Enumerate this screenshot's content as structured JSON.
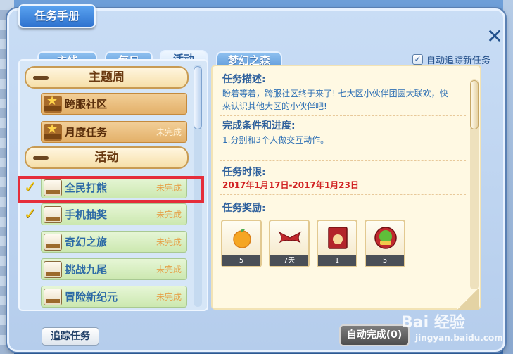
{
  "window": {
    "title": "任务手册",
    "close_symbol": "✕"
  },
  "tabs": [
    {
      "label": "主线",
      "active": false
    },
    {
      "label": "每日",
      "active": false
    },
    {
      "label": "活动",
      "active": true
    },
    {
      "label": "梦幻之森",
      "active": false
    }
  ],
  "auto_track": {
    "label": "自动追踪新任务",
    "checked": true,
    "check_symbol": "✓"
  },
  "task_list": {
    "categories": [
      {
        "label": "主题周"
      },
      {
        "label": "活动"
      }
    ],
    "items": [
      {
        "name": "跨服社区",
        "status": "",
        "icon": "theme-week-icon",
        "checked": false
      },
      {
        "name": "月度任务",
        "status": "未完成",
        "icon": "theme-week-icon",
        "checked": false
      },
      {
        "name": "全民打熊",
        "status": "未完成",
        "icon": "activity-icon",
        "checked": true
      },
      {
        "name": "手机抽奖",
        "status": "未完成",
        "icon": "activity-icon",
        "checked": true
      },
      {
        "name": "奇幻之旅",
        "status": "未完成",
        "icon": "activity-icon",
        "checked": false
      },
      {
        "name": "挑战九尾",
        "status": "未完成",
        "icon": "activity-icon",
        "checked": false
      },
      {
        "name": "冒险新纪元",
        "status": "未完成",
        "icon": "activity-icon",
        "checked": false
      }
    ],
    "check_symbol": "✓"
  },
  "detail": {
    "desc_title": "任务描述:",
    "desc_text_1": "盼着等着，跨服社区终于来了! 七大区小伙伴团圆大联欢，快",
    "desc_text_2": "来认识其他大区的小伙伴吧!",
    "progress_title": "完成条件和进度:",
    "progress_text": "1.分别和3个人做交互动作。",
    "time_title": "任务时限:",
    "time_text": "2017年1月17日-2017年1月23日",
    "reward_title": "任务奖励:",
    "rewards": [
      {
        "icon": "orange-fruit-icon",
        "count": "5"
      },
      {
        "icon": "red-wings-icon",
        "count": "7天"
      },
      {
        "icon": "red-card-icon",
        "count": "1"
      },
      {
        "icon": "growth-apple-icon",
        "count": "5"
      }
    ]
  },
  "buttons": {
    "track": "追踪任务",
    "auto_complete": "自动完成(0)"
  },
  "watermark": {
    "main": "Bai 经验",
    "url": "jingyan.baidu.com"
  },
  "colors": {
    "accent": "#2f73cf",
    "highlight": "#e52d3a",
    "date": "#d12222"
  }
}
